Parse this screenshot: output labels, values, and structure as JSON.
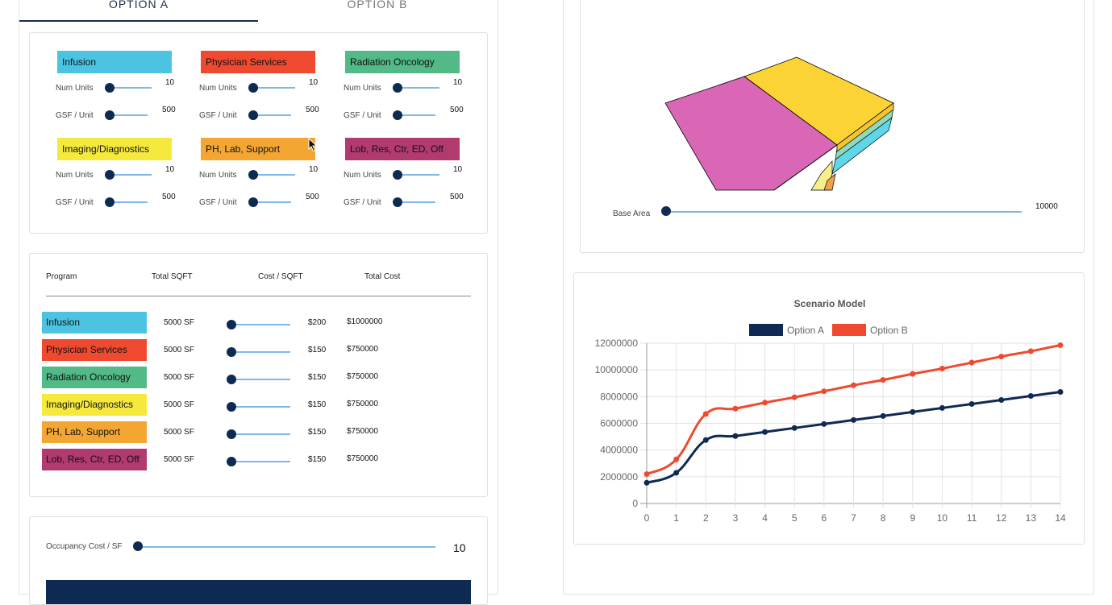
{
  "tabs": {
    "option_a": "OPTION A",
    "option_b": "OPTION B"
  },
  "slider_labels": {
    "num_units": "Num Units",
    "gsf_unit": "GSF / Unit"
  },
  "programs": [
    {
      "name": "Infusion",
      "color": "#4dc3e2",
      "num_units": "10",
      "gsf_unit": "500"
    },
    {
      "name": "Physician Services",
      "color": "#ef4a30",
      "num_units": "10",
      "gsf_unit": "500"
    },
    {
      "name": "Radiation Oncology",
      "color": "#52b987",
      "num_units": "10",
      "gsf_unit": "500"
    },
    {
      "name": "Imaging/Diagnostics",
      "color": "#f5e93e",
      "num_units": "10",
      "gsf_unit": "500"
    },
    {
      "name": "PH, Lab, Support",
      "color": "#f4a633",
      "num_units": "10",
      "gsf_unit": "500"
    },
    {
      "name": "Lob, Res, Ctr, ED, Off",
      "color": "#b13a6f",
      "num_units": "10",
      "gsf_unit": "500"
    }
  ],
  "cost_table": {
    "headers": {
      "program": "Program",
      "total_sqft": "Total SQFT",
      "cost_sqft": "Cost / SQFT",
      "total_cost": "Total Cost"
    },
    "rows": [
      {
        "sqft": "5000 SF",
        "cost": "$200",
        "total": "$1000000"
      },
      {
        "sqft": "5000 SF",
        "cost": "$150",
        "total": "$750000"
      },
      {
        "sqft": "5000 SF",
        "cost": "$150",
        "total": "$750000"
      },
      {
        "sqft": "5000 SF",
        "cost": "$150",
        "total": "$750000"
      },
      {
        "sqft": "5000 SF",
        "cost": "$150",
        "total": "$750000"
      },
      {
        "sqft": "5000 SF",
        "cost": "$150",
        "total": "$750000"
      }
    ]
  },
  "occupancy": {
    "label": "Occupancy Cost / SF",
    "value": "10"
  },
  "base_area": {
    "label": "Base Area",
    "value": "10000"
  },
  "colors": {
    "navy": "#0f2a52",
    "slider": "#7fb8e6",
    "option_a": "#0f2a52",
    "option_b": "#ef4a30",
    "massing_pink": "#da67b5",
    "massing_yellow": "#fbd334"
  },
  "chart_data": {
    "type": "line",
    "title": "Scenario Model",
    "xlabel": "",
    "ylabel": "",
    "x": [
      0,
      1,
      2,
      3,
      4,
      5,
      6,
      7,
      8,
      9,
      10,
      11,
      12,
      13,
      14
    ],
    "ylim": [
      0,
      12000000
    ],
    "yticks": [
      "0",
      "2000000",
      "4000000",
      "6000000",
      "8000000",
      "10000000",
      "12000000"
    ],
    "grid": true,
    "legend": "top",
    "series": [
      {
        "name": "Option A",
        "color": "#0f2a52",
        "values": [
          1550000,
          2300000,
          4750000,
          5050000,
          5350000,
          5650000,
          5950000,
          6250000,
          6550000,
          6850000,
          7150000,
          7450000,
          7750000,
          8050000,
          8350000
        ]
      },
      {
        "name": "Option B",
        "color": "#ef4a30",
        "values": [
          2200000,
          3300000,
          6700000,
          7100000,
          7550000,
          7950000,
          8400000,
          8850000,
          9250000,
          9700000,
          10100000,
          10550000,
          11000000,
          11400000,
          11850000
        ]
      }
    ]
  }
}
